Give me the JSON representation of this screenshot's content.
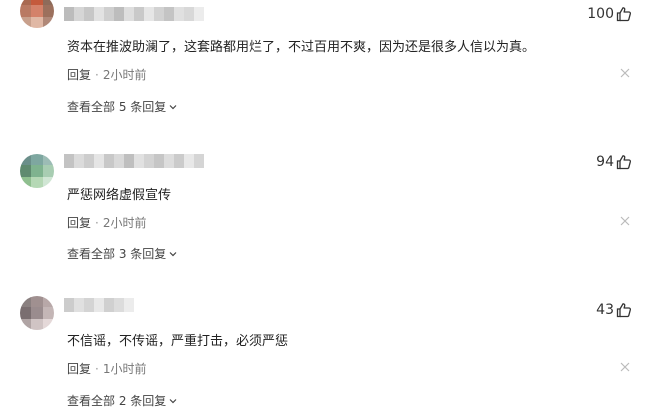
{
  "comments": [
    {
      "likes": "100",
      "text": "资本在推波助澜了，这套路都用烂了，不过百用不爽，因为还是很多人信以为真。",
      "reply_label": "回复",
      "separator": "·",
      "time": "2小时前",
      "view_replies": "查看全部 5 条回复"
    },
    {
      "likes": "94",
      "text": "严惩网络虚假宣传",
      "reply_label": "回复",
      "separator": "·",
      "time": "2小时前",
      "view_replies": "查看全部 3 条回复"
    },
    {
      "likes": "43",
      "text": "不信谣，不传谣，严重打击，必须严惩",
      "reply_label": "回复",
      "separator": "·",
      "time": "1小时前",
      "view_replies": "查看全部 2 条回复"
    }
  ],
  "icons": {
    "like": "thumbs-up-icon",
    "close": "close-icon",
    "chevron": "chevron-down-icon"
  },
  "colors": {
    "text": "#222222",
    "meta": "#777777",
    "icon": "#333333",
    "close": "#bbbbbb"
  }
}
